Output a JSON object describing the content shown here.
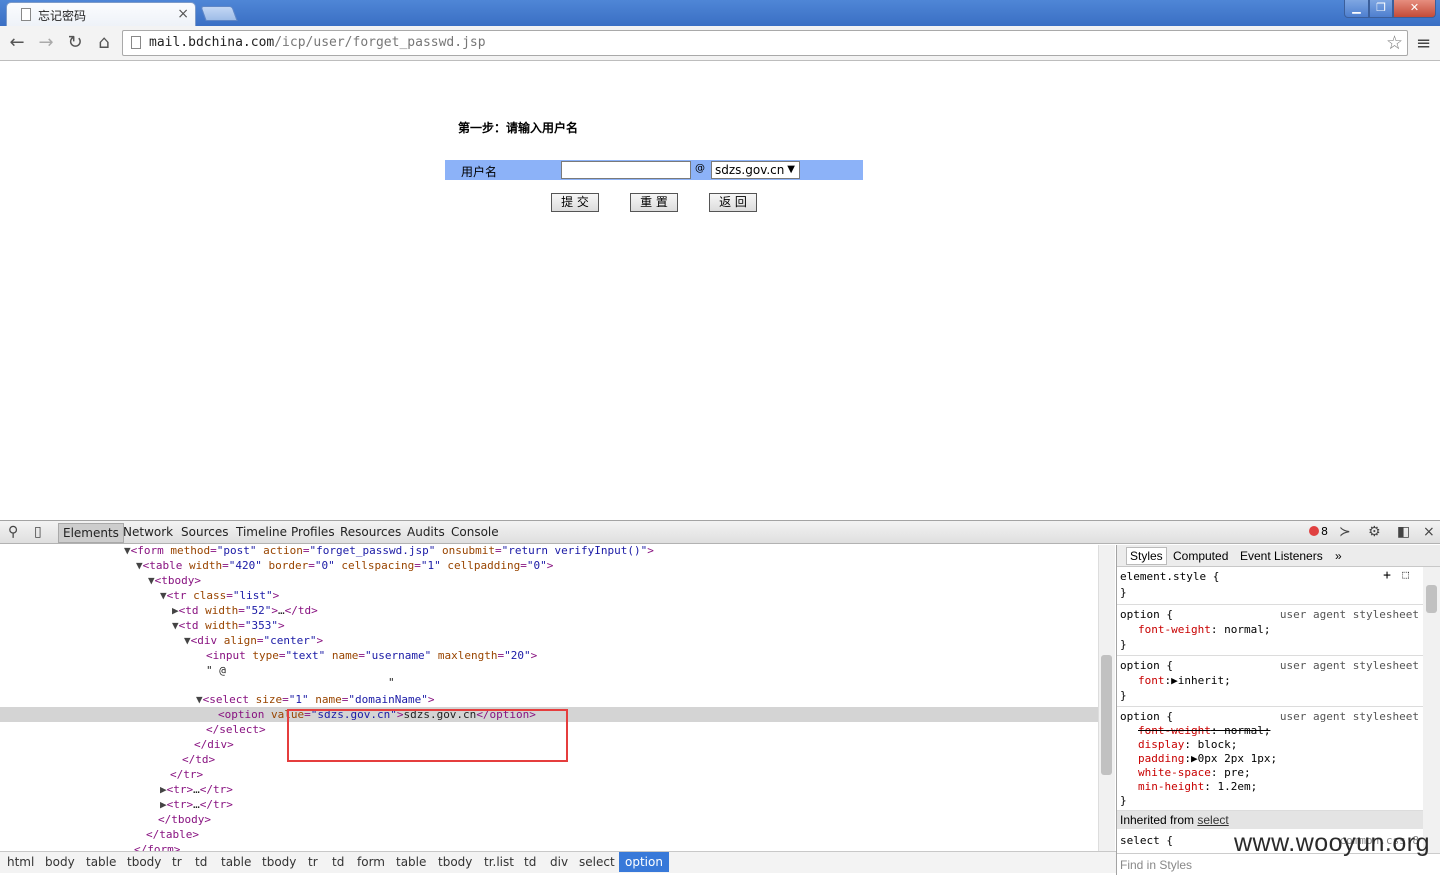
{
  "browser": {
    "tab_title": "忘记密码",
    "tab_close": "×",
    "url_host": "mail.bdchina.com",
    "url_path": "/icp/user/forget_passwd.jsp",
    "window_buttons": {
      "minimize": "▁",
      "maximize": "❐",
      "close": "✕"
    },
    "icons": {
      "back": "←",
      "forward": "→",
      "reload": "↻",
      "home": "⌂",
      "star": "☆",
      "menu": "≡"
    }
  },
  "page": {
    "step_title": "第一步：请输入用户名",
    "username_label": "用户名",
    "username_value": "",
    "at_sign": "@",
    "domain_selected": "sdzs.gov.cn",
    "buttons": {
      "submit": "提 交",
      "reset": "重 置",
      "back": "返 回"
    },
    "row_color": "#8cb2f8"
  },
  "devtools": {
    "tabs": [
      "Elements",
      "Network",
      "Sources",
      "Timeline",
      "Profiles",
      "Resources",
      "Audits",
      "Console"
    ],
    "selected_tab": "Elements",
    "error_count": "8",
    "dom_lines": [
      "<form method=\"post\" action=\"forget_passwd.jsp\" onsubmit=\"return verifyInput()\">",
      "<table width=\"420\" border=\"0\" cellspacing=\"1\" cellpadding=\"0\">",
      "<tbody>",
      "<tr class=\"list\">",
      "<td width=\"52\">…</td>",
      "<td width=\"353\">",
      "<div align=\"center\">",
      "<input type=\"text\" name=\"username\" maxlength=\"20\">",
      "\" @",
      "\"",
      "<select size=\"1\" name=\"domainName\">",
      "<option value=\"sdzs.gov.cn\">sdzs.gov.cn</option>",
      "</select>",
      "</div>",
      "</td>",
      "</tr>",
      "<tr>…</tr>",
      "<tr>…</tr>",
      "</tbody>",
      "</table>",
      "</form>"
    ],
    "breadcrumbs": [
      "html",
      "body",
      "table",
      "tbody",
      "tr",
      "td",
      "table",
      "tbody",
      "tr",
      "td",
      "form",
      "table",
      "tbody",
      "tr.list",
      "td",
      "div",
      "select",
      "option"
    ],
    "styles_tabs": [
      "Styles",
      "Computed",
      "Event Listeners",
      "»"
    ],
    "styles": {
      "element_style": "element.style {",
      "close_brace": "}",
      "rule1_selector": "option {",
      "rule1_source": "user agent stylesheet",
      "rule1_prop": "font-weight",
      "rule1_val": " normal;",
      "rule2_selector": "option {",
      "rule2_source": "user agent stylesheet",
      "rule2_prop": "font",
      "rule2_val": "▶inherit;",
      "rule3_selector": "option {",
      "rule3_source": "user agent stylesheet",
      "rule3_props": [
        {
          "prop": "font-weight",
          "val": " normal;"
        },
        {
          "prop": "display",
          "val": " block;"
        },
        {
          "prop": "padding",
          "val": "▶0px 2px 1px;"
        },
        {
          "prop": "white-space",
          "val": " pre;"
        },
        {
          "prop": "min-height",
          "val": " 1.2em;"
        }
      ],
      "inherited_prefix": "Inherited from ",
      "inherited_link": "select",
      "select_selector": "select {",
      "select_source": "common.css:8",
      "find_placeholder": "Find in Styles"
    }
  },
  "watermark": "www.wooyun.org",
  "colors": {
    "highlight_box": "#e53d3d",
    "crumb_selected": "#3879d9",
    "titlebar": "#4f86d6"
  }
}
